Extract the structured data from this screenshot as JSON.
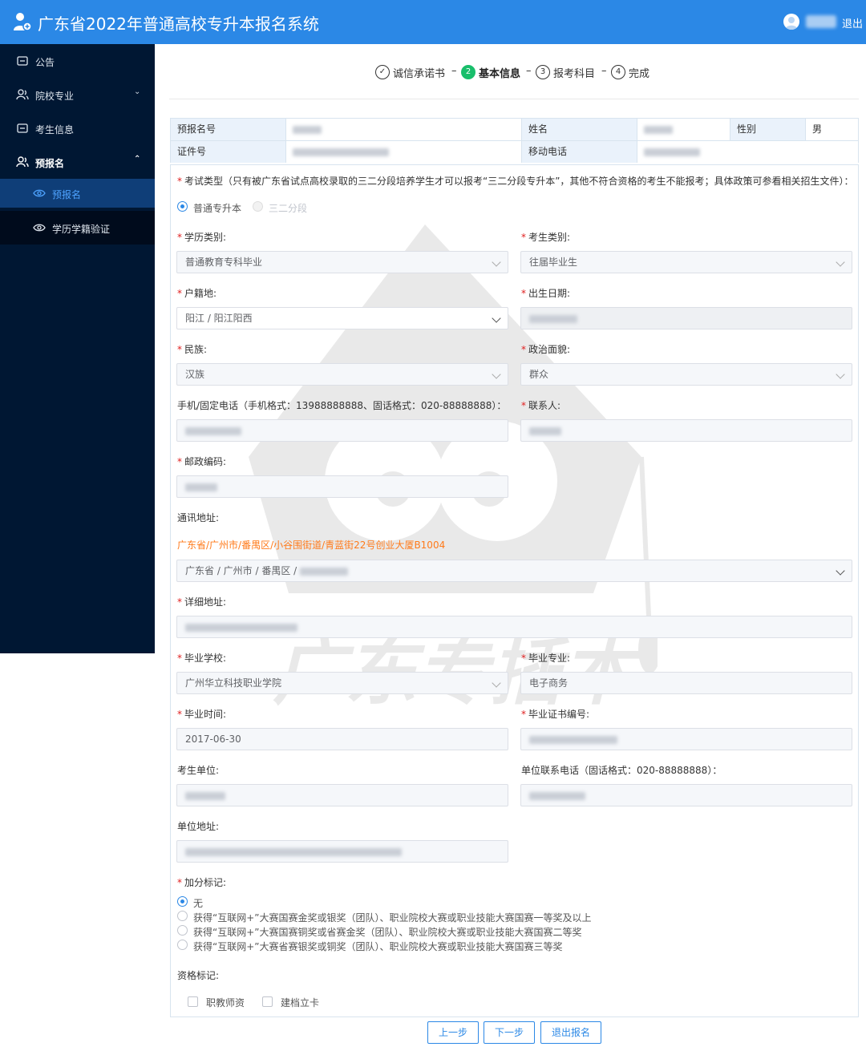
{
  "header": {
    "title": "广东省2022年普通高校专升本报名系统",
    "logout": "退出"
  },
  "sidebar": {
    "items": [
      {
        "label": "公告"
      },
      {
        "label": "院校专业"
      },
      {
        "label": "考生信息"
      },
      {
        "label": "预报名"
      },
      {
        "label": "预报名"
      },
      {
        "label": "学历学籍验证"
      }
    ]
  },
  "steps": [
    {
      "num": "✓",
      "label": "诚信承诺书"
    },
    {
      "num": "2",
      "label": "基本信息"
    },
    {
      "num": "3",
      "label": "报考科目"
    },
    {
      "num": "4",
      "label": "完成"
    }
  ],
  "step_sep": "–",
  "info": {
    "pre_no_label": "预报名号",
    "name_label": "姓名",
    "gender_label": "性别",
    "gender_value": "男",
    "id_label": "证件号",
    "mobile_label": "移动电话"
  },
  "form": {
    "exam_type_label": "考试类型（只有被广东省试点高校录取的三二分段培养学生才可以报考“三二分段专升本”，其他不符合资格的考生不能报考；具体政策可参看相关招生文件）：",
    "exam_type_options": [
      "普通专升本",
      "三二分段"
    ],
    "edu_type_label": "学历类别:",
    "edu_type_value": "普通教育专科毕业",
    "student_type_label": "考生类别:",
    "student_type_value": "往届毕业生",
    "hukou_label": "户籍地:",
    "hukou_value": "阳江 / 阳江阳西",
    "birth_label": "出生日期:",
    "ethnic_label": "民族:",
    "ethnic_value": "汉族",
    "political_label": "政治面貌:",
    "political_value": "群众",
    "phone_label": "手机/固定电话（手机格式：13988888888、固话格式：020-88888888）：",
    "contact_label": "联系人:",
    "postcode_label": "邮政编码:",
    "address_label": "通讯地址:",
    "address_hint": "广东省/广州市/番禺区/小谷围街道/青蓝街22号创业大厦B1004",
    "address_select": "广东省 / 广州市 / 番禺区 /",
    "detail_label": "详细地址:",
    "school_label": "毕业学校:",
    "school_value": "广州华立科技职业学院",
    "major_label": "毕业专业:",
    "major_value": "电子商务",
    "grad_time_label": "毕业时间:",
    "grad_time_value": "2017-06-30",
    "cert_label": "毕业证书编号:",
    "unit_label": "考生单位:",
    "unit_phone_label": "单位联系电话（固话格式：020-88888888）：",
    "unit_addr_label": "单位地址:",
    "bonus_label": "加分标记:",
    "bonus_options": [
      "无",
      "获得“互联网+”大赛国赛金奖或银奖（团队）、职业院校大赛或职业技能大赛国赛一等奖及以上",
      "获得“互联网+”大赛国赛铜奖或省赛金奖（团队）、职业院校大赛或职业技能大赛国赛二等奖",
      "获得“互联网+”大赛省赛银奖或铜奖（团队）、职业院校大赛或职业技能大赛国赛三等奖"
    ],
    "qual_label": "资格标记:",
    "qual_options": [
      "职教师资",
      "建档立卡"
    ]
  },
  "buttons": {
    "prev": "上一步",
    "next": "下一步",
    "quit": "退出报名"
  },
  "watermark": "广东专插本",
  "colors": {
    "topbar": "#2b88e6",
    "sidebar": "#001733",
    "active": "#4ea3ff",
    "success": "#19be6b",
    "hint": "#ff7a1a"
  }
}
